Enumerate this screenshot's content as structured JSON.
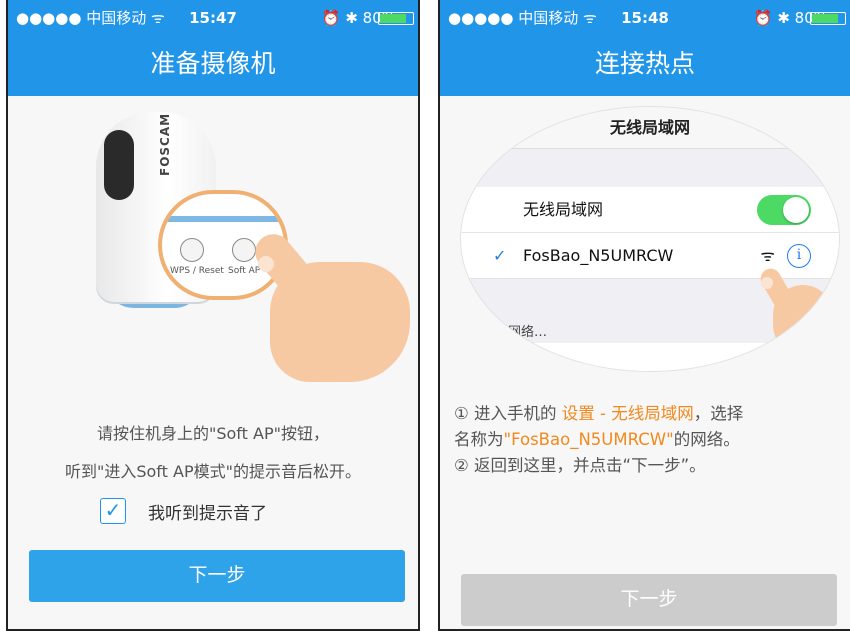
{
  "left_screen": {
    "status": {
      "carrier": "●●●●● 中国移动 ᯤ",
      "time": "15:47",
      "right": "⏰ ✱ 80%"
    },
    "title": "准备摄像机",
    "image": {
      "brand": "FOSCAM",
      "button_1_label": "WPS / Reset",
      "button_2_label": "Soft AP"
    },
    "instruction_line_1": "请按住机身上的\"Soft AP\"按钮，",
    "instruction_line_2": "听到\"进入Soft AP模式\"的提示音后松开。",
    "checkbox_label": "我听到提示音了",
    "checkbox_checked": true,
    "next_label": "下一步"
  },
  "right_screen": {
    "status": {
      "carrier": "●●●●● 中国移动 ᯤ",
      "time": "15:48",
      "right": "⏰ ✱ 80%"
    },
    "title": "连接热点",
    "wifi_panel": {
      "header": "无线局域网",
      "toggle_label": "无线局域网",
      "toggle_on": true,
      "network_name": "FosBao_N5UMRCW",
      "searching_text": "取网络…"
    },
    "step1_prefix": "① 进入手机的 ",
    "step1_highlight": "设置 - 无线局域网",
    "step1_suffix": "，选择",
    "step1_line2_prefix": "名称为",
    "step1_line2_highlight": "\"FosBao_N5UMRCW\"",
    "step1_line2_suffix": "的网络。",
    "step2": "② 返回到这里，并点击“下一步”。",
    "next_label": "下一步"
  },
  "colors": {
    "header_blue": "#2196e8",
    "button_blue": "#2fa3ea",
    "disabled_gray": "#cccccc",
    "highlight_orange": "#f2891e",
    "toggle_green": "#4cd964"
  },
  "battery_level": 0.8
}
